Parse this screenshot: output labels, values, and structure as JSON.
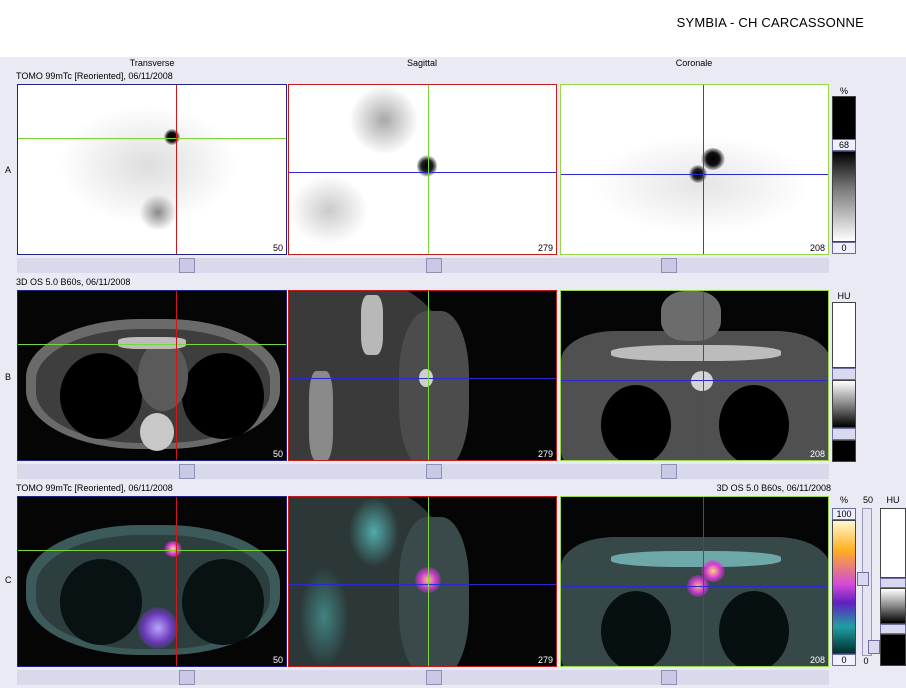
{
  "site_title": "SYMBIA - CH CARCASSONNE",
  "columns": {
    "transverse": "Transverse",
    "sagittal": "Sagittal",
    "coronal": "Coronale"
  },
  "rows": {
    "a": {
      "letter": "A",
      "caption": "TOMO 99mTc [Reoriented], 06/11/2008",
      "slices": {
        "transverse": "50",
        "sagittal": "279",
        "coronal": "208"
      },
      "colorbar": {
        "unit": "%",
        "max": "68",
        "min": "0"
      }
    },
    "b": {
      "letter": "B",
      "caption": "3D  OS  5.0  B60s, 06/11/2008",
      "slices": {
        "transverse": "50",
        "sagittal": "279",
        "coronal": "208"
      },
      "colorbar": {
        "unit": "HU"
      }
    },
    "c": {
      "letter": "C",
      "caption": "TOMO 99mTc [Reoriented], 06/11/2008",
      "caption_right": "3D  OS  5.0  B60s, 06/11/2008",
      "slices": {
        "transverse": "50",
        "sagittal": "279",
        "coronal": "208"
      },
      "colorbar": {
        "unit": "%",
        "max": "100",
        "min": "0",
        "blend": "50",
        "blend_min": "0",
        "unit2": "HU"
      }
    }
  },
  "colors": {
    "crosshair_red": "#d01818",
    "crosshair_green": "#7bd63a",
    "crosshair_blue": "#2a2ad0",
    "border_navy": "#22237a",
    "workspace": "#eaeaf4"
  }
}
